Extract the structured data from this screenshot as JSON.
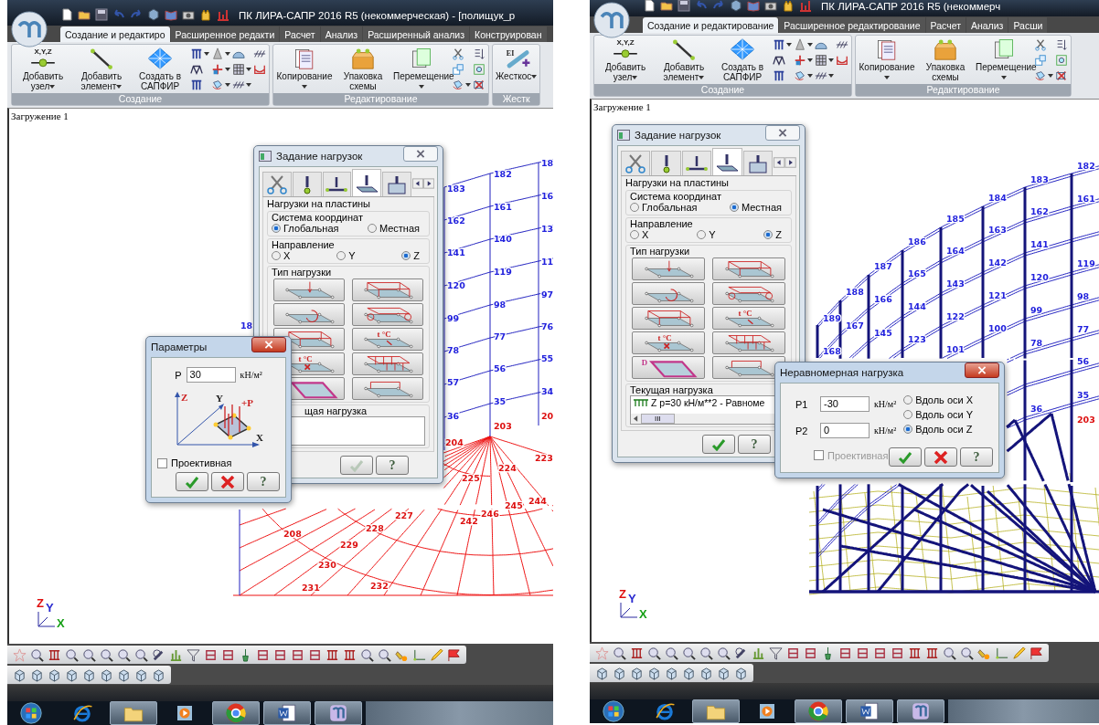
{
  "screens": [
    {
      "title": "ПК ЛИРА-САПР  2016 R5 (некоммерческая) - [полищук_р",
      "tabs": [
        {
          "label": "Создание и редактиро",
          "selected": true
        },
        {
          "label": "Расширенное редакти",
          "selected": false
        },
        {
          "label": "Расчет",
          "selected": false
        },
        {
          "label": "Анализ",
          "selected": false
        },
        {
          "label": "Расширенный анализ",
          "selected": false
        },
        {
          "label": "Конструирован",
          "selected": false
        }
      ],
      "ribbon_groups": [
        {
          "label": "Создание",
          "buttons": [
            {
              "label": "Добавить узел",
              "dropdown": true,
              "icon_text": "X,Y,Z"
            },
            {
              "label": "Добавить элемент",
              "dropdown": true
            },
            {
              "label": "Создать в САПФИР",
              "dropdown": false
            }
          ]
        },
        {
          "label": "Редактирование",
          "buttons": [
            {
              "label": "Копирование",
              "dropdown": true
            },
            {
              "label": "Упаковка схемы",
              "dropdown": false
            },
            {
              "label": "Перемещение",
              "dropdown": true
            }
          ]
        },
        {
          "label": "Жестк",
          "buttons": [
            {
              "label": "Жесткос",
              "dropdown": true,
              "icon_text": "EI"
            }
          ]
        }
      ],
      "load_case": "Загружение 1",
      "node_labels": [
        {
          "text": "183",
          "color": "#2222dd"
        },
        {
          "text": "182",
          "color": "#2222dd"
        },
        {
          "text": "18",
          "color": "#2222dd"
        },
        {
          "text": "162",
          "color": "#2222dd"
        },
        {
          "text": "161",
          "color": "#2222dd"
        },
        {
          "text": "16",
          "color": "#2222dd"
        },
        {
          "text": "141",
          "color": "#2222dd"
        },
        {
          "text": "140",
          "color": "#2222dd"
        },
        {
          "text": "13",
          "color": "#2222dd"
        },
        {
          "text": "120",
          "color": "#2222dd"
        },
        {
          "text": "119",
          "color": "#2222dd"
        },
        {
          "text": "11",
          "color": "#2222dd"
        },
        {
          "text": "99",
          "color": "#2222dd"
        },
        {
          "text": "98",
          "color": "#2222dd"
        },
        {
          "text": "97",
          "color": "#2222dd"
        },
        {
          "text": "78",
          "color": "#2222dd"
        },
        {
          "text": "77",
          "color": "#2222dd"
        },
        {
          "text": "76",
          "color": "#2222dd"
        },
        {
          "text": "57",
          "color": "#2222dd"
        },
        {
          "text": "56",
          "color": "#2222dd"
        },
        {
          "text": "55",
          "color": "#2222dd"
        },
        {
          "text": "36",
          "color": "#2222dd"
        },
        {
          "text": "35",
          "color": "#2222dd"
        },
        {
          "text": "34",
          "color": "#2222dd"
        },
        {
          "text": "204",
          "color": "#dd1111"
        },
        {
          "text": "203",
          "color": "#dd1111"
        },
        {
          "text": "20",
          "color": "#dd1111"
        },
        {
          "text": "223",
          "color": "#dd1111"
        },
        {
          "text": "224",
          "color": "#dd1111"
        },
        {
          "text": "225",
          "color": "#dd1111"
        },
        {
          "text": "227",
          "color": "#dd1111"
        },
        {
          "text": "228",
          "color": "#dd1111"
        },
        {
          "text": "229",
          "color": "#dd1111"
        },
        {
          "text": "230",
          "color": "#dd1111"
        },
        {
          "text": "231",
          "color": "#dd1111"
        },
        {
          "text": "232",
          "color": "#dd1111"
        },
        {
          "text": "242",
          "color": "#dd1111"
        },
        {
          "text": "245",
          "color": "#dd1111"
        },
        {
          "text": "244",
          "color": "#dd1111"
        },
        {
          "text": "246",
          "color": "#dd1111"
        },
        {
          "text": "208",
          "color": "#dd1111"
        },
        {
          "text": "18",
          "color": "#2222dd"
        }
      ],
      "axes": {
        "z": "Z",
        "y": "Y",
        "x": "X"
      },
      "loads_dialog": {
        "title": "Задание нагрузок",
        "tabs": [
          {
            "selected": false
          },
          {
            "selected": false
          },
          {
            "selected": false
          },
          {
            "selected": true
          },
          {
            "selected": false
          }
        ],
        "section": "Нагрузки на пластины",
        "coord_group": {
          "label": "Система координат",
          "options": [
            {
              "label": "Глобальная",
              "selected": true
            },
            {
              "label": "Местная",
              "selected": false
            }
          ]
        },
        "direction_group": {
          "label": "Направление",
          "options": [
            {
              "label": "X",
              "selected": false
            },
            {
              "label": "Y",
              "selected": false
            },
            {
              "label": "Z",
              "selected": true
            }
          ]
        },
        "type_group": {
          "label": "Тип нагрузки",
          "types": [
            {
              "kind": "point"
            },
            {
              "kind": "band"
            },
            {
              "kind": "moment"
            },
            {
              "kind": "band-moment"
            },
            {
              "kind": "frame"
            },
            {
              "kind": "temperature",
              "glyph": "t °C"
            },
            {
              "kind": "gradient",
              "glyph": "t °C"
            },
            {
              "kind": "multi"
            },
            {
              "kind": "edge"
            },
            {
              "kind": "trapezoid"
            }
          ]
        },
        "current": {
          "label": "щая нагрузка"
        },
        "ok_disabled": true,
        "help": "?"
      },
      "sub_dialog": {
        "kind": "params",
        "title": "Параметры",
        "fields": [
          {
            "label": "P",
            "value": "30",
            "unit": "кН/м²"
          }
        ],
        "diagram": {
          "z": "Z",
          "y": "Y",
          "x": "X",
          "force": "+P"
        },
        "projective": {
          "label": "Проективная",
          "checked": false,
          "disabled": false
        },
        "help": "?"
      },
      "taskbar": [
        {
          "kind": "start",
          "running": false
        },
        {
          "kind": "browser",
          "running": false
        },
        {
          "kind": "folder",
          "running": true
        },
        {
          "kind": "player",
          "running": false
        },
        {
          "kind": "chrome",
          "running": true
        },
        {
          "kind": "word",
          "running": true
        },
        {
          "kind": "app",
          "running": true
        }
      ]
    },
    {
      "title": "ПК ЛИРА-САПР  2016 R5 (некоммерч",
      "tabs": [
        {
          "label": "Создание и редактирование",
          "selected": true
        },
        {
          "label": "Расширенное редактирование",
          "selected": false
        },
        {
          "label": "Расчет",
          "selected": false
        },
        {
          "label": "Анализ",
          "selected": false
        },
        {
          "label": "Расши",
          "selected": false
        }
      ],
      "ribbon_groups": [
        {
          "label": "Создание",
          "buttons": [
            {
              "label": "Добавить узел",
              "dropdown": true,
              "icon_text": "X,Y,Z"
            },
            {
              "label": "Добавить элемент",
              "dropdown": true
            },
            {
              "label": "Создать в САПФИР",
              "dropdown": false
            }
          ]
        },
        {
          "label": "Редактирование",
          "buttons": [
            {
              "label": "Копирование",
              "dropdown": true
            },
            {
              "label": "Упаковка схемы",
              "dropdown": false
            },
            {
              "label": "Перемещение",
              "dropdown": true
            }
          ]
        }
      ],
      "load_case": "Загружение 1",
      "node_labels": [
        {
          "text": "184",
          "color": "#2222dd"
        },
        {
          "text": "183",
          "color": "#2222dd"
        },
        {
          "text": "182",
          "color": "#2222dd"
        },
        {
          "text": "185",
          "color": "#2222dd"
        },
        {
          "text": "186",
          "color": "#2222dd"
        },
        {
          "text": "187",
          "color": "#2222dd"
        },
        {
          "text": "188",
          "color": "#2222dd"
        },
        {
          "text": "189",
          "color": "#2222dd"
        },
        {
          "text": "163",
          "color": "#2222dd"
        },
        {
          "text": "162",
          "color": "#2222dd"
        },
        {
          "text": "161",
          "color": "#2222dd"
        },
        {
          "text": "164",
          "color": "#2222dd"
        },
        {
          "text": "165",
          "color": "#2222dd"
        },
        {
          "text": "166",
          "color": "#2222dd"
        },
        {
          "text": "167",
          "color": "#2222dd"
        },
        {
          "text": "168",
          "color": "#2222dd"
        },
        {
          "text": "142",
          "color": "#2222dd"
        },
        {
          "text": "141",
          "color": "#2222dd"
        },
        {
          "text": "119",
          "color": "#2222dd"
        },
        {
          "text": "143",
          "color": "#2222dd"
        },
        {
          "text": "144",
          "color": "#2222dd"
        },
        {
          "text": "145",
          "color": "#2222dd"
        },
        {
          "text": "121",
          "color": "#2222dd"
        },
        {
          "text": "120",
          "color": "#2222dd"
        },
        {
          "text": "98",
          "color": "#2222dd"
        },
        {
          "text": "122",
          "color": "#2222dd"
        },
        {
          "text": "123",
          "color": "#2222dd"
        },
        {
          "text": "100",
          "color": "#2222dd"
        },
        {
          "text": "99",
          "color": "#2222dd"
        },
        {
          "text": "77",
          "color": "#2222dd"
        },
        {
          "text": "101",
          "color": "#2222dd"
        },
        {
          "text": "78",
          "color": "#2222dd"
        },
        {
          "text": "56",
          "color": "#2222dd"
        },
        {
          "text": "35",
          "color": "#2222dd"
        },
        {
          "text": "36",
          "color": "#2222dd"
        },
        {
          "text": "203",
          "color": "#dd1111"
        }
      ],
      "axes": {
        "z": "Z",
        "y": "Y",
        "x": "X"
      },
      "loads_dialog": {
        "title": "Задание нагрузок",
        "tabs": [
          {
            "selected": false
          },
          {
            "selected": false
          },
          {
            "selected": false
          },
          {
            "selected": true
          },
          {
            "selected": false
          }
        ],
        "section": "Нагрузки на пластины",
        "coord_group": {
          "label": "Система координат",
          "options": [
            {
              "label": "Глобальная",
              "selected": false
            },
            {
              "label": "Местная",
              "selected": true
            }
          ]
        },
        "direction_group": {
          "label": "Направление",
          "options": [
            {
              "label": "X",
              "selected": false
            },
            {
              "label": "Y",
              "selected": false
            },
            {
              "label": "Z",
              "selected": true
            }
          ]
        },
        "type_group": {
          "label": "Тип нагрузки",
          "types": [
            {
              "kind": "point"
            },
            {
              "kind": "band"
            },
            {
              "kind": "moment"
            },
            {
              "kind": "band-moment"
            },
            {
              "kind": "frame"
            },
            {
              "kind": "temperature",
              "glyph": "t °C"
            },
            {
              "kind": "gradient",
              "glyph": "t °C"
            },
            {
              "kind": "multi"
            },
            {
              "kind": "edge",
              "glyph": "D"
            },
            {
              "kind": "trapezoid"
            }
          ]
        },
        "current": {
          "label": "Текущая нагрузка",
          "value": "Z p=30 кН/м**2 - Равноме",
          "thumb": "III"
        },
        "ok_disabled": false,
        "help": "?"
      },
      "sub_dialog": {
        "kind": "nonuniform",
        "title": "Неравномерная нагрузка",
        "fields": [
          {
            "label": "P1",
            "value": "-30",
            "unit": "кН/м²"
          },
          {
            "label": "P2",
            "value": "0",
            "unit": "кН/м²"
          }
        ],
        "axes": [
          {
            "label": "Вдоль оси X",
            "selected": false
          },
          {
            "label": "Вдоль оси Y",
            "selected": false
          },
          {
            "label": "Вдоль оси Z",
            "selected": true
          }
        ],
        "projective": {
          "label": "Проективная",
          "checked": false,
          "disabled": true
        },
        "help": "?"
      },
      "taskbar": [
        {
          "kind": "start",
          "running": false
        },
        {
          "kind": "browser",
          "running": false
        },
        {
          "kind": "folder",
          "running": true
        },
        {
          "kind": "player",
          "running": false
        },
        {
          "kind": "chrome",
          "running": true
        },
        {
          "kind": "word",
          "running": true
        },
        {
          "kind": "app",
          "running": true
        }
      ]
    }
  ]
}
